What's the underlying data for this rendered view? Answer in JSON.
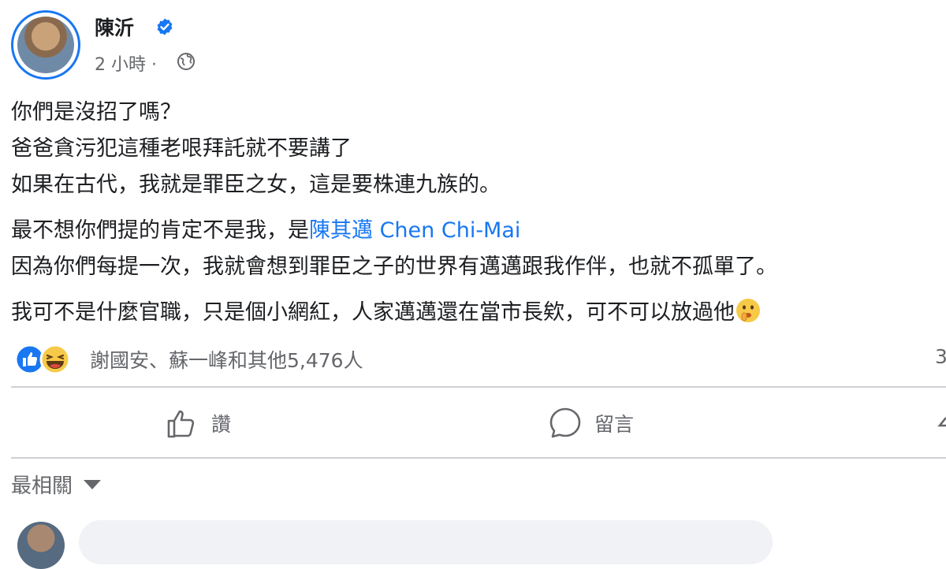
{
  "post": {
    "author": "陳沂",
    "verified": true,
    "time": "2 小時 ·",
    "privacy_icon": "globe-icon",
    "paragraphs": [
      {
        "lines": [
          "你們是沒招了嗎？",
          "爸爸貪污犯這種老哏拜託就不要講了",
          "如果在古代，我就是罪臣之女，這是要株連九族的。"
        ]
      },
      {
        "line1_prefix": "最不想你們提的肯定不是我，是",
        "mention": "陳其邁 Chen Chi-Mai",
        "line2": "因為你們每提一次，我就會想到罪臣之子的世界有邁邁跟我作伴，也就不孤單了。"
      },
      {
        "line": "我可不是什麼官職，只是個小網紅，人家邁邁還在當市長欸，可不可以放過他",
        "emoji": "shushing-face-emoji"
      }
    ]
  },
  "reactions": {
    "icons": [
      "like-icon",
      "haha-icon"
    ],
    "summary": "謝國安、蘇一峰和其他5,476人",
    "comments_count_peek": "3"
  },
  "actions": {
    "like_label": "讚",
    "comment_label": "留言"
  },
  "comments": {
    "sort_label": "最相關"
  },
  "colors": {
    "accent": "#1877f2",
    "secondary_text": "#65676b",
    "divider": "#ced0d4"
  }
}
